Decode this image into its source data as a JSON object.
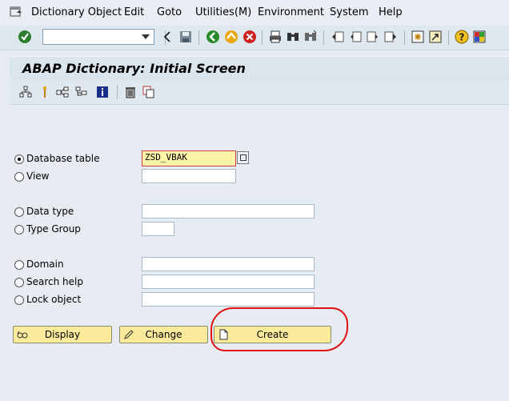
{
  "menubar": {
    "items": [
      "Dictionary Object",
      "Edit",
      "Goto",
      "Utilities(M)",
      "Environment",
      "System",
      "Help"
    ]
  },
  "toolbar": {
    "command_field_value": "",
    "icons": [
      "enter-icon",
      "back-icon",
      "exit-icon",
      "cancel-icon",
      "print-icon",
      "find-icon",
      "find-next-icon",
      "first-page-icon",
      "previous-page-icon",
      "next-page-icon",
      "last-page-icon",
      "create-session-icon",
      "shortcut-icon",
      "help-icon",
      "customize-layout-icon"
    ]
  },
  "title": "ABAP Dictionary: Initial Screen",
  "form": {
    "database_table_label": "Database table",
    "database_table_value": "ZSD_VBAK",
    "view_label": "View",
    "view_value": "",
    "data_type_label": "Data type",
    "data_type_value": "",
    "type_group_label": "Type Group",
    "type_group_value": "",
    "domain_label": "Domain",
    "domain_value": "",
    "search_help_label": "Search help",
    "search_help_value": "",
    "lock_object_label": "Lock object",
    "lock_object_value": "",
    "selected_option": "Database table"
  },
  "buttons": {
    "display": "Display",
    "change": "Change",
    "create": "Create"
  },
  "colors": {
    "button_bg": "#f9ea9c",
    "annotation": "#e01010",
    "active_field": "#fcf3a8"
  }
}
